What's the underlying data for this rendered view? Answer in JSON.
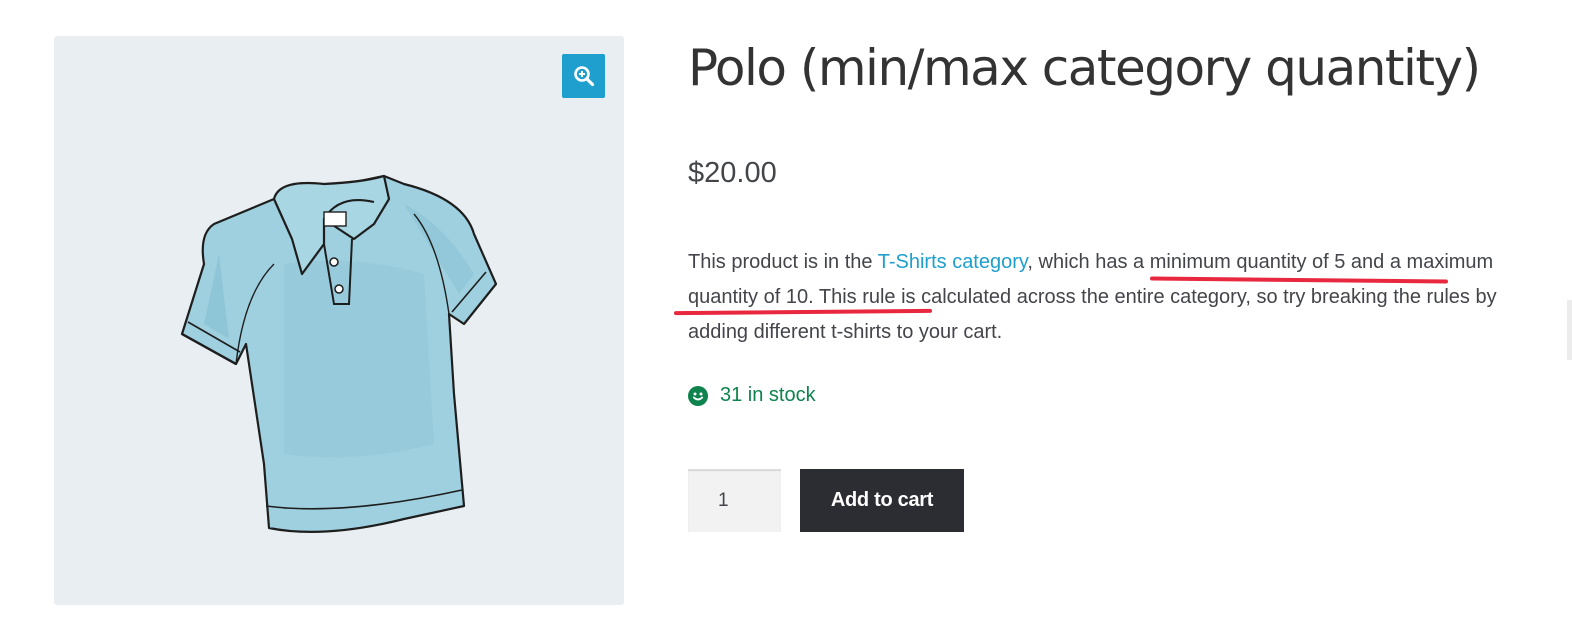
{
  "product": {
    "title": "Polo (min/max category quantity)",
    "price": "$20.00",
    "description": {
      "part1": "This product is in the ",
      "link_text": "T-Shirts category",
      "part2": ", which has a ",
      "highlight1": "minimum quantity of 5 and a",
      "line2_start": "maximum quantity of 10.",
      "part3": " This rule is calculated across the entire category, so try breaking the rules by adding different t-shirts to your cart."
    },
    "stock_text": "31 in stock",
    "quantity_value": "1",
    "add_to_cart_label": "Add to cart"
  },
  "icons": {
    "zoom": "zoom-in-icon",
    "stock": "smiley-icon"
  },
  "colors": {
    "accent": "#1e9fce",
    "stock_green": "#0f834d",
    "button_dark": "#2c2d33",
    "highlight_red": "#e8283f",
    "image_bg": "#e9eef2"
  }
}
